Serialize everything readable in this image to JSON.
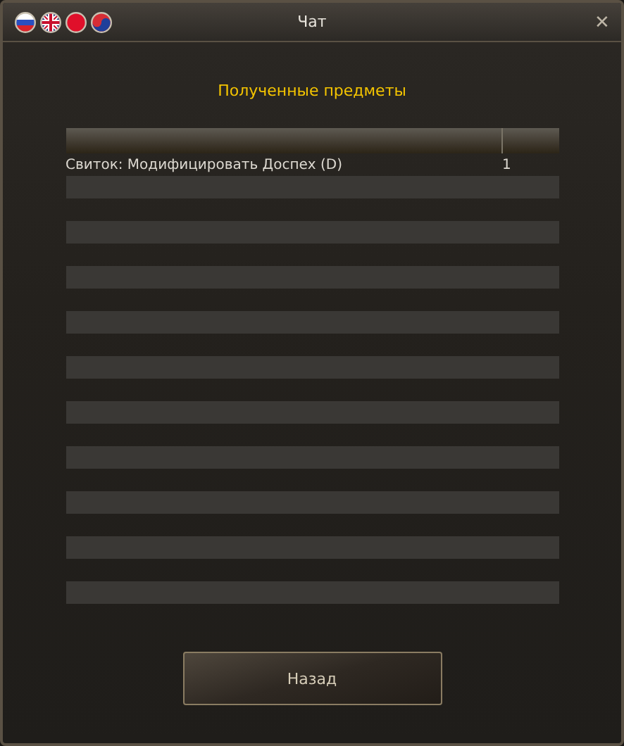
{
  "window": {
    "title": "Чат",
    "close": "✕"
  },
  "flags": [
    {
      "kind": "ru"
    },
    {
      "kind": "uk"
    },
    {
      "kind": "jp"
    },
    {
      "kind": "kr"
    }
  ],
  "heading": "Полученные предметы",
  "table": {
    "rows": [
      {
        "name": "Свиток: Модифицировать Доспех (D)",
        "count": "1"
      }
    ]
  },
  "back_button": "Назад"
}
